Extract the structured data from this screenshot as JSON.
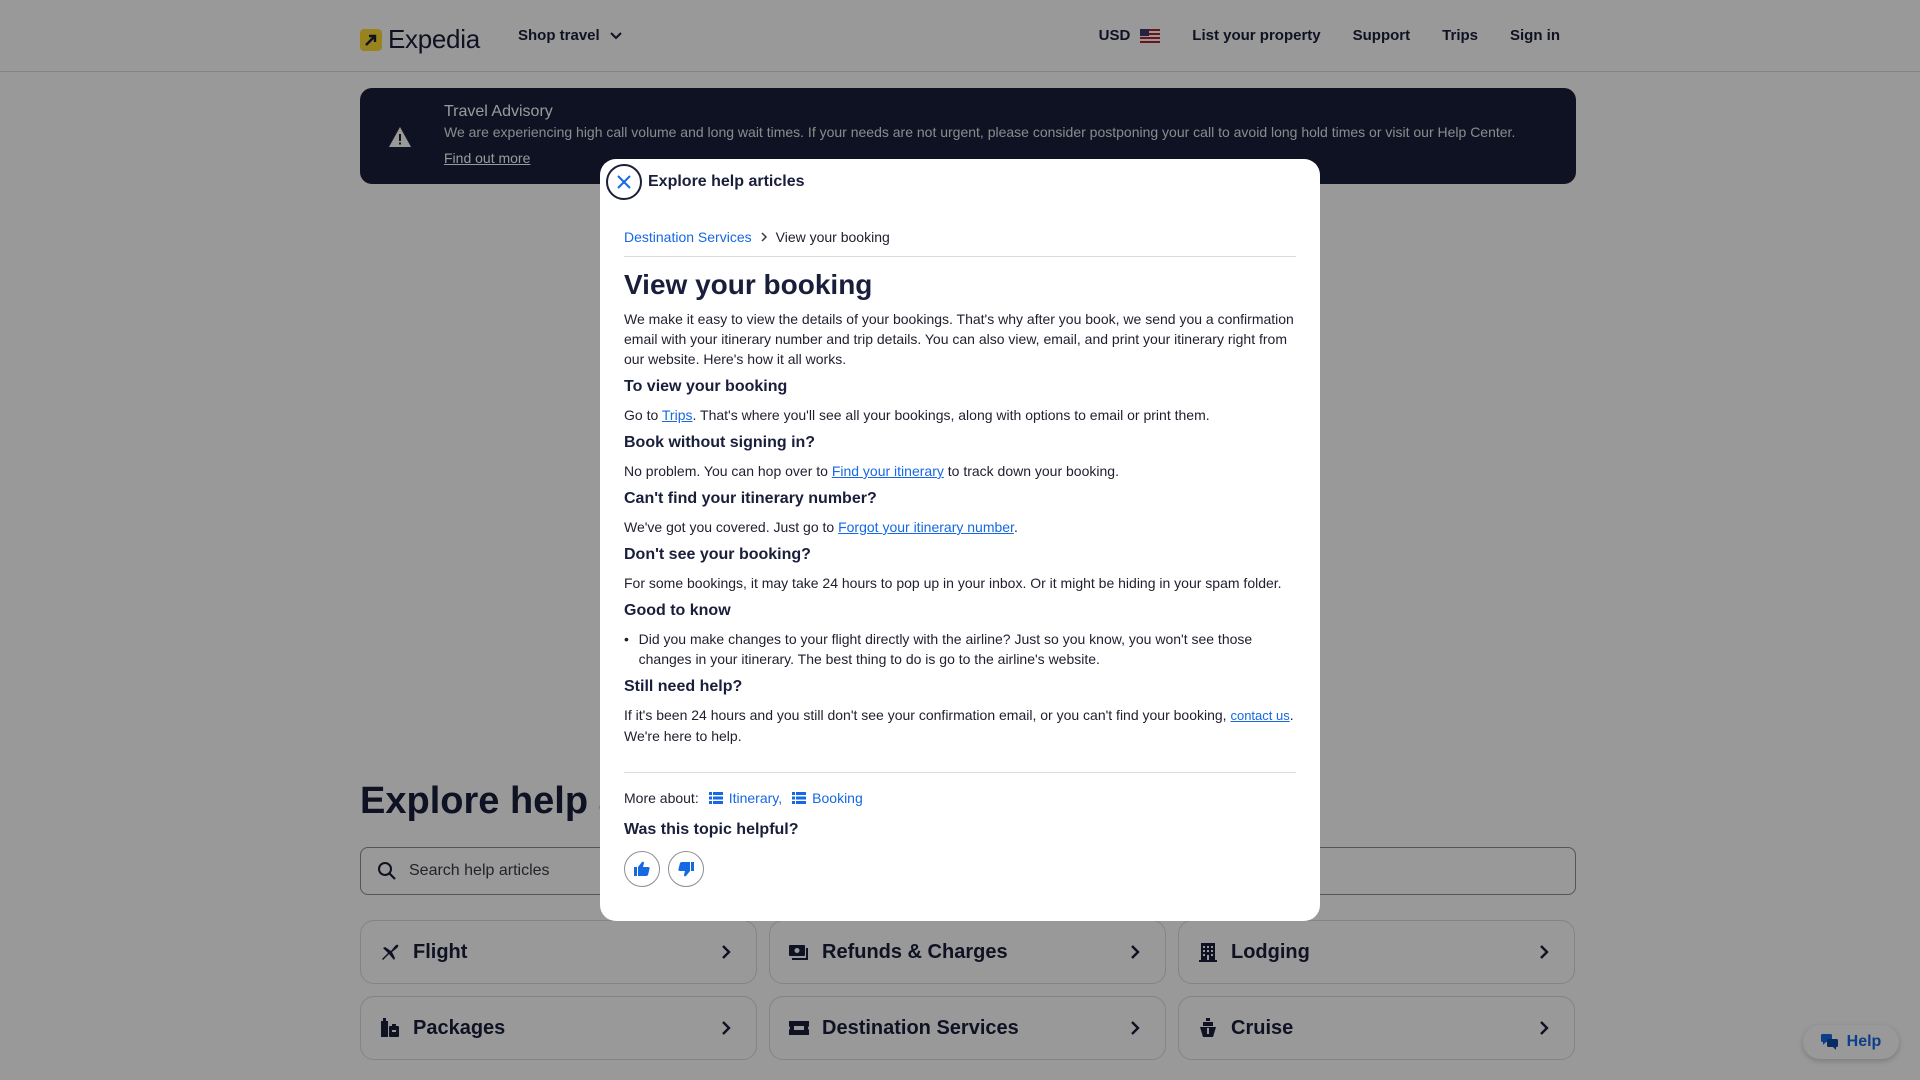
{
  "header": {
    "brand": "Expedia",
    "shop_travel": "Shop travel",
    "currency": "USD",
    "nav": [
      "List your property",
      "Support",
      "Trips",
      "Sign in"
    ]
  },
  "advisory": {
    "title": "Travel Advisory",
    "text": "We are experiencing high call volume and long wait times. If your needs are not urgent, please consider postponing your call to avoid long hold times or visit our Help Center.",
    "link": "Find out more"
  },
  "explore": {
    "title": "Explore help articles",
    "search_placeholder": "Search help articles",
    "categories": [
      {
        "label": "Flight",
        "icon": "airplane-icon"
      },
      {
        "label": "Refunds & Charges",
        "icon": "money-icon"
      },
      {
        "label": "Lodging",
        "icon": "building-icon"
      },
      {
        "label": "Packages",
        "icon": "luggage-icon"
      },
      {
        "label": "Destination Services",
        "icon": "ticket-icon"
      },
      {
        "label": "Cruise",
        "icon": "ship-icon"
      }
    ]
  },
  "help_fab": {
    "label": "Help"
  },
  "modal": {
    "title": "Explore help articles",
    "breadcrumb": {
      "parent": "Destination Services",
      "current": "View your booking"
    },
    "article": {
      "title": "View your booking",
      "intro": "We make it easy to view the details of your bookings. That's why after you book, we send you a confirmation email with your itinerary number and trip details. You can also view, email, and print your itinerary right from our website. Here's how it all works.",
      "s1_heading": "To view your booking",
      "s1_pre": "Go to ",
      "s1_link": "Trips",
      "s1_post": ". That's where you'll see all your bookings, along with options to email or print them.",
      "s2_heading": "Book without signing in?",
      "s2_pre": "No problem. You can hop over to ",
      "s2_link": "Find your itinerary",
      "s2_post": " to track down your booking.",
      "s3_heading": "Can't find your itinerary number?",
      "s3_pre": "We've got you covered. Just go to ",
      "s3_link": "Forgot your itinerary number",
      "s3_post": ".",
      "s4_heading": "Don't see your booking?",
      "s4_text": "For some bookings, it may take 24 hours to pop up in your inbox. Or it might be hiding in your spam folder.",
      "s5_heading": "Good to know",
      "s5_bullet": "Did you make changes to your flight directly with the airline? Just so you know, you won't see those changes in your itinerary. The best thing to do is go to the airline's website.",
      "s6_heading": "Still need help?",
      "s6_pre": "If it's been 24 hours and you still don't see your confirmation email, or you can't find your booking, ",
      "s6_link": "contact us",
      "s6_post": ". We're here to help."
    },
    "more_about": {
      "label": "More about:",
      "tags": [
        "Itinerary,",
        "Booking"
      ]
    },
    "helpful": {
      "question": "Was this topic helpful?"
    }
  },
  "colors": {
    "brand_yellow": "#fddb32",
    "link_blue": "#1668e3",
    "navy": "#191e3b"
  }
}
